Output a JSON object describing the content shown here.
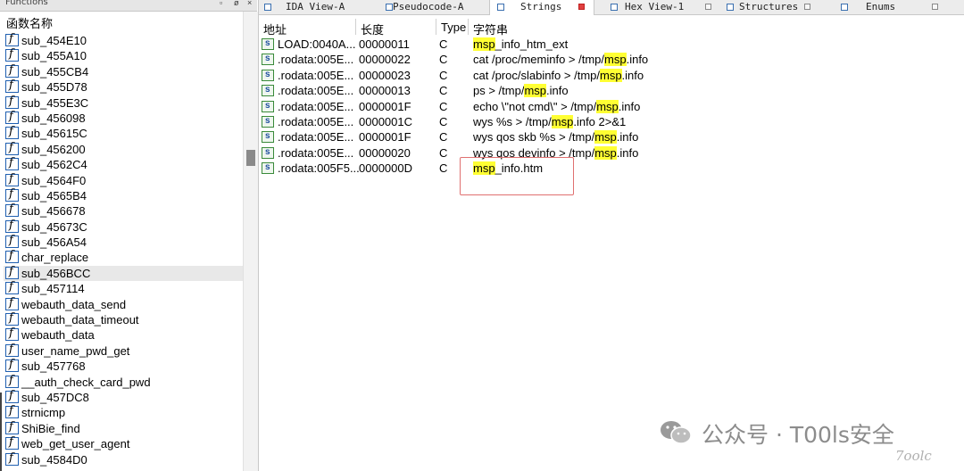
{
  "functions_panel": {
    "title": "Functions",
    "column_header": "函数名称",
    "selected_index": 15,
    "items": [
      "sub_454E10",
      "sub_455A10",
      "sub_455CB4",
      "sub_455D78",
      "sub_455E3C",
      "sub_456098",
      "sub_45615C",
      "sub_456200",
      "sub_4562C4",
      "sub_4564F0",
      "sub_4565B4",
      "sub_456678",
      "sub_45673C",
      "sub_456A54",
      "char_replace",
      "sub_456BCC",
      "sub_457114",
      "webauth_data_send",
      "webauth_data_timeout",
      "webauth_data",
      "user_name_pwd_get",
      "sub_457768",
      "__auth_check_card_pwd",
      "sub_457DC8",
      "strnicmp",
      "ShiBie_find",
      "web_get_user_agent",
      "sub_4584D0"
    ]
  },
  "tabs": [
    {
      "label": "IDA View-A",
      "active": false
    },
    {
      "label": "Pseudocode-A",
      "active": false
    },
    {
      "label": "Strings",
      "active": true
    },
    {
      "label": "Hex View-1",
      "active": false
    },
    {
      "label": "Structures",
      "active": false
    },
    {
      "label": "Enums",
      "active": false
    }
  ],
  "strings_table": {
    "headers": {
      "address": "地址",
      "length": "长度",
      "type": "Type",
      "string": "字符串"
    },
    "rows": [
      {
        "address": "LOAD:0040A...",
        "length": "00000011",
        "type": "C",
        "pre": "",
        "hl": "msp",
        "post": "_info_htm_ext"
      },
      {
        "address": ".rodata:005E...",
        "length": "00000022",
        "type": "C",
        "pre": "cat /proc/meminfo > /tmp/",
        "hl": "msp",
        "post": ".info"
      },
      {
        "address": ".rodata:005E...",
        "length": "00000023",
        "type": "C",
        "pre": "cat /proc/slabinfo > /tmp/",
        "hl": "msp",
        "post": ".info"
      },
      {
        "address": ".rodata:005E...",
        "length": "00000013",
        "type": "C",
        "pre": "ps > /tmp/",
        "hl": "msp",
        "post": ".info"
      },
      {
        "address": ".rodata:005E...",
        "length": "0000001F",
        "type": "C",
        "pre": "echo \\\"not cmd\\\" > /tmp/",
        "hl": "msp",
        "post": ".info"
      },
      {
        "address": ".rodata:005E...",
        "length": "0000001C",
        "type": "C",
        "pre": "wys %s > /tmp/",
        "hl": "msp",
        "post": ".info 2>&1"
      },
      {
        "address": ".rodata:005E...",
        "length": "0000001F",
        "type": "C",
        "pre": "wys qos skb %s > /tmp/",
        "hl": "msp",
        "post": ".info"
      },
      {
        "address": ".rodata:005E...",
        "length": "00000020",
        "type": "C",
        "pre": "wys qos devinfo > /tmp/",
        "hl": "msp",
        "post": ".info"
      },
      {
        "address": ".rodata:005F5...",
        "length": "0000000D",
        "type": "C",
        "pre": "",
        "hl": "msp",
        "post": "_info.htm"
      }
    ]
  },
  "watermark": {
    "text": "公众号 · T00ls安全",
    "sub": "7oolc"
  },
  "colors": {
    "highlight": "#ffff33",
    "annotation_box": "#e07070"
  }
}
